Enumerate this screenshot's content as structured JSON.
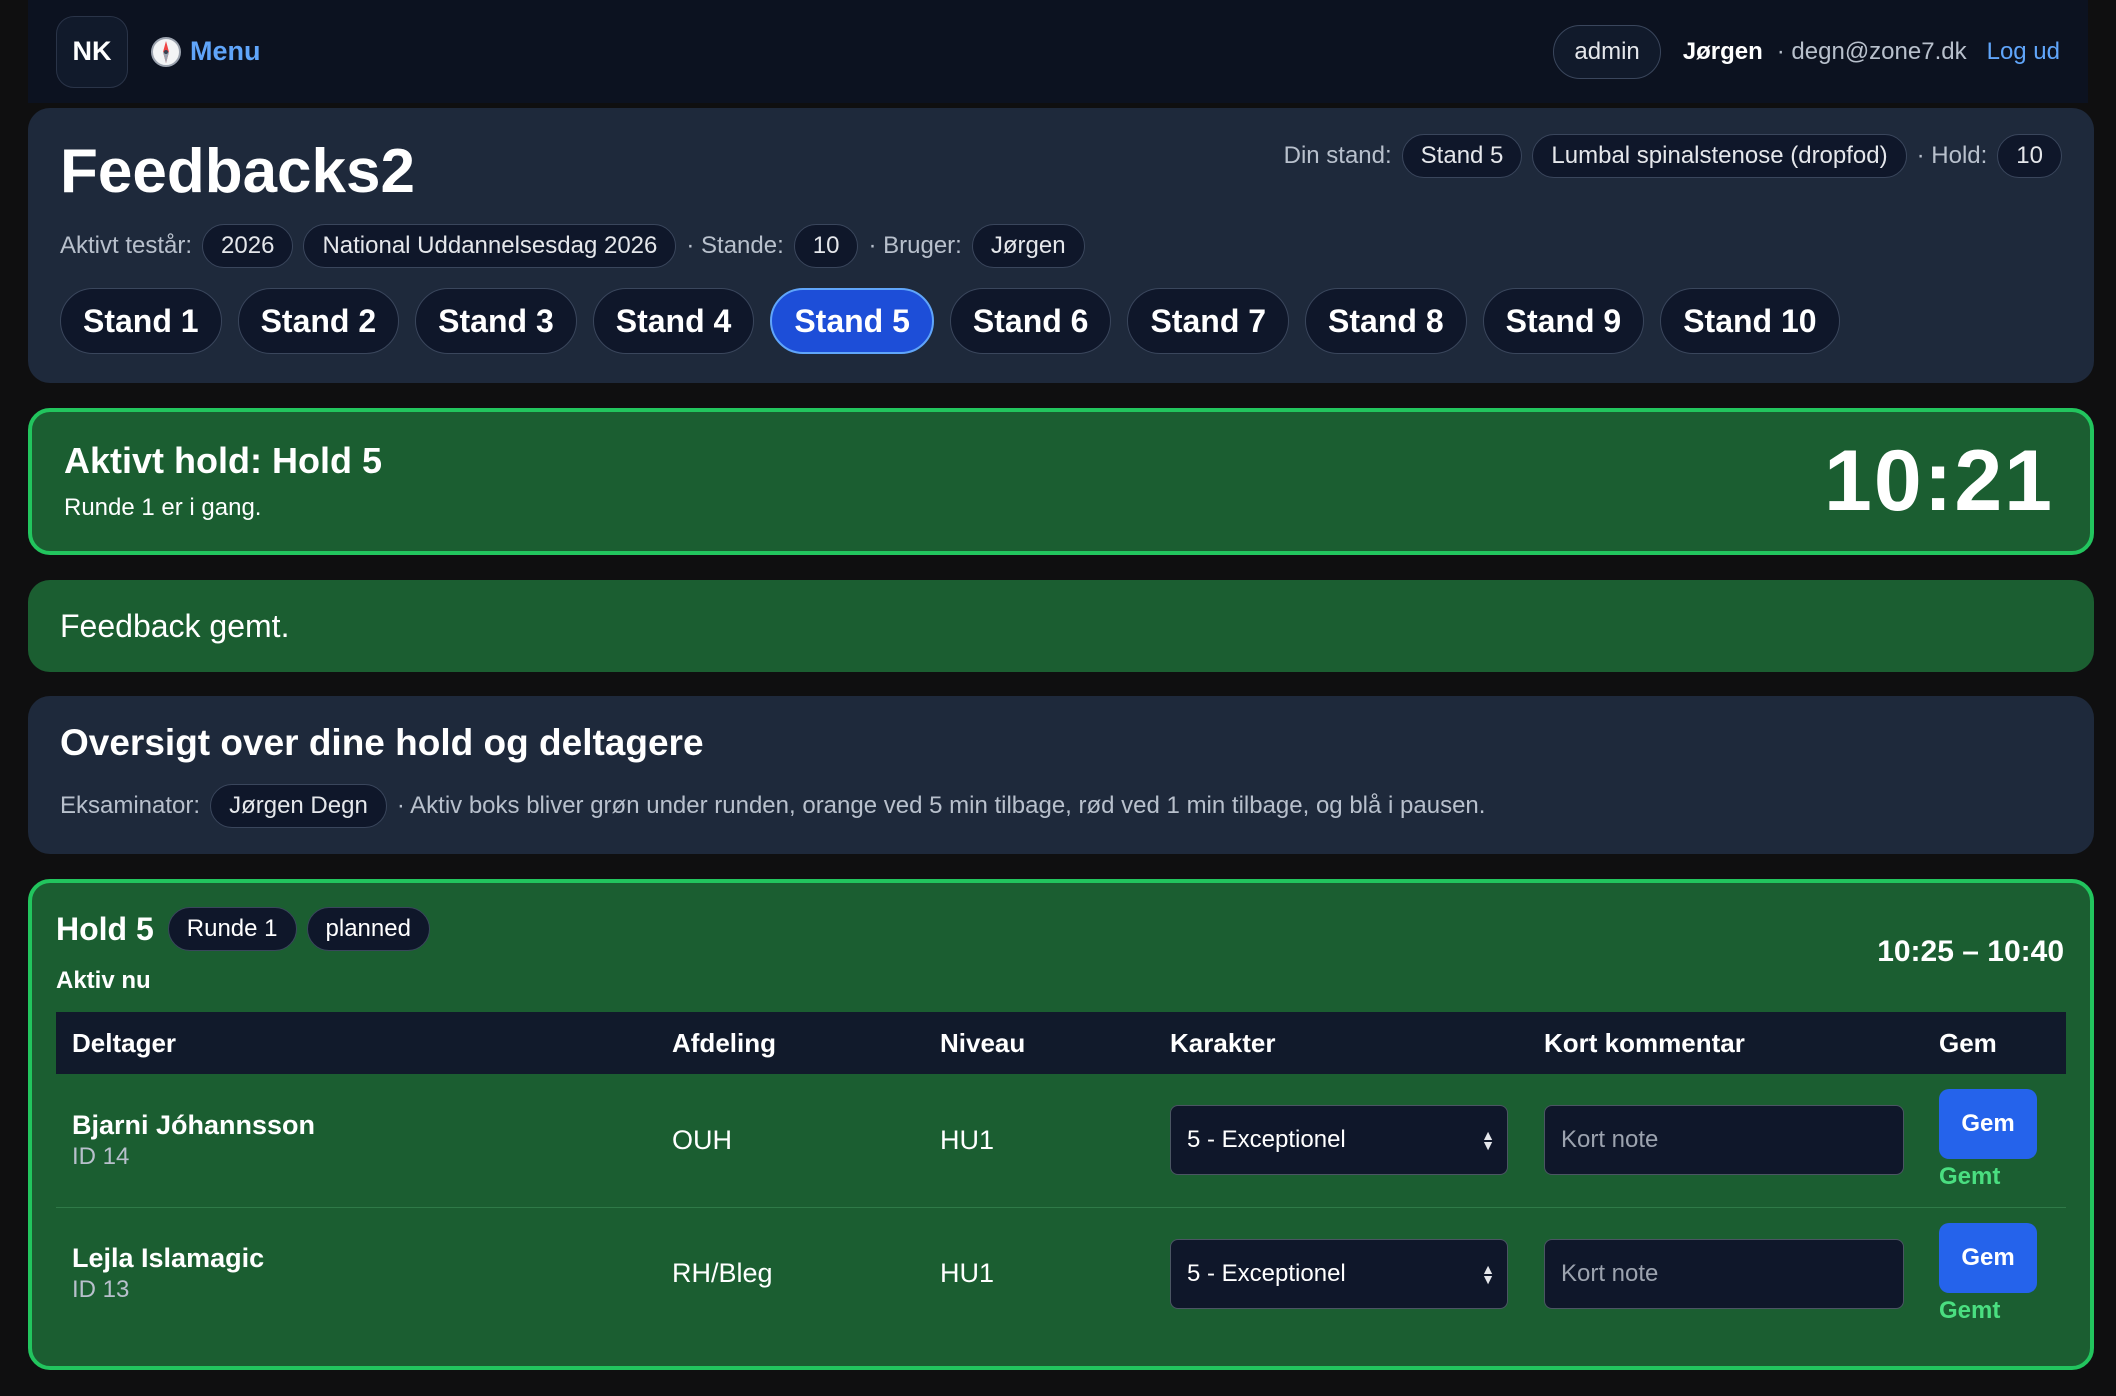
{
  "topbar": {
    "logo": "NK",
    "menu_label": "Menu",
    "role": "admin",
    "user_name": "Jørgen",
    "user_email": "· degn@zone7.dk",
    "logout": "Log ud"
  },
  "header": {
    "title": "Feedbacks2",
    "din_stand_label": "Din stand:",
    "din_stand": "Stand 5",
    "case": "Lumbal spinalstenose (dropfod)",
    "hold_label": "· Hold:",
    "hold": "10",
    "aktivt_label": "Aktivt testår:",
    "year": "2026",
    "event": "National Uddannelsesdag 2026",
    "stande_label": "· Stande:",
    "stande": "10",
    "bruger_label": "· Bruger:",
    "bruger": "Jørgen"
  },
  "stands": [
    "Stand 1",
    "Stand 2",
    "Stand 3",
    "Stand 4",
    "Stand 5",
    "Stand 6",
    "Stand 7",
    "Stand 8",
    "Stand 9",
    "Stand 10"
  ],
  "active_stand_index": 4,
  "active": {
    "title": "Aktivt hold: Hold 5",
    "subtitle": "Runde 1 er i gang.",
    "timer": "10:21"
  },
  "flash": "Feedback gemt.",
  "overview": {
    "title": "Oversigt over dine hold og deltagere",
    "examiner_label": "Eksaminator:",
    "examiner": "Jørgen Degn",
    "note": "· Aktiv boks bliver grøn under runden, orange ved 5 min tilbage, rød ved 1 min tilbage, og blå i pausen."
  },
  "hold": {
    "title": "Hold 5",
    "round": "Runde 1",
    "status": "planned",
    "active_label": "Aktiv nu",
    "time": "10:25 – 10:40",
    "columns": [
      "Deltager",
      "Afdeling",
      "Niveau",
      "Karakter",
      "Kort kommentar",
      "Gem"
    ],
    "rows": [
      {
        "name": "Bjarni Jóhannsson",
        "id": "ID 14",
        "afdeling": "OUH",
        "niveau": "HU1",
        "karakter": "5 - Exceptionel",
        "placeholder": "Kort note",
        "button": "Gem",
        "saved": "Gemt"
      },
      {
        "name": "Lejla Islamagic",
        "id": "ID 13",
        "afdeling": "RH/Bleg",
        "niveau": "HU1",
        "karakter": "5 - Exceptionel",
        "placeholder": "Kort note",
        "button": "Gem",
        "saved": "Gemt"
      }
    ]
  }
}
